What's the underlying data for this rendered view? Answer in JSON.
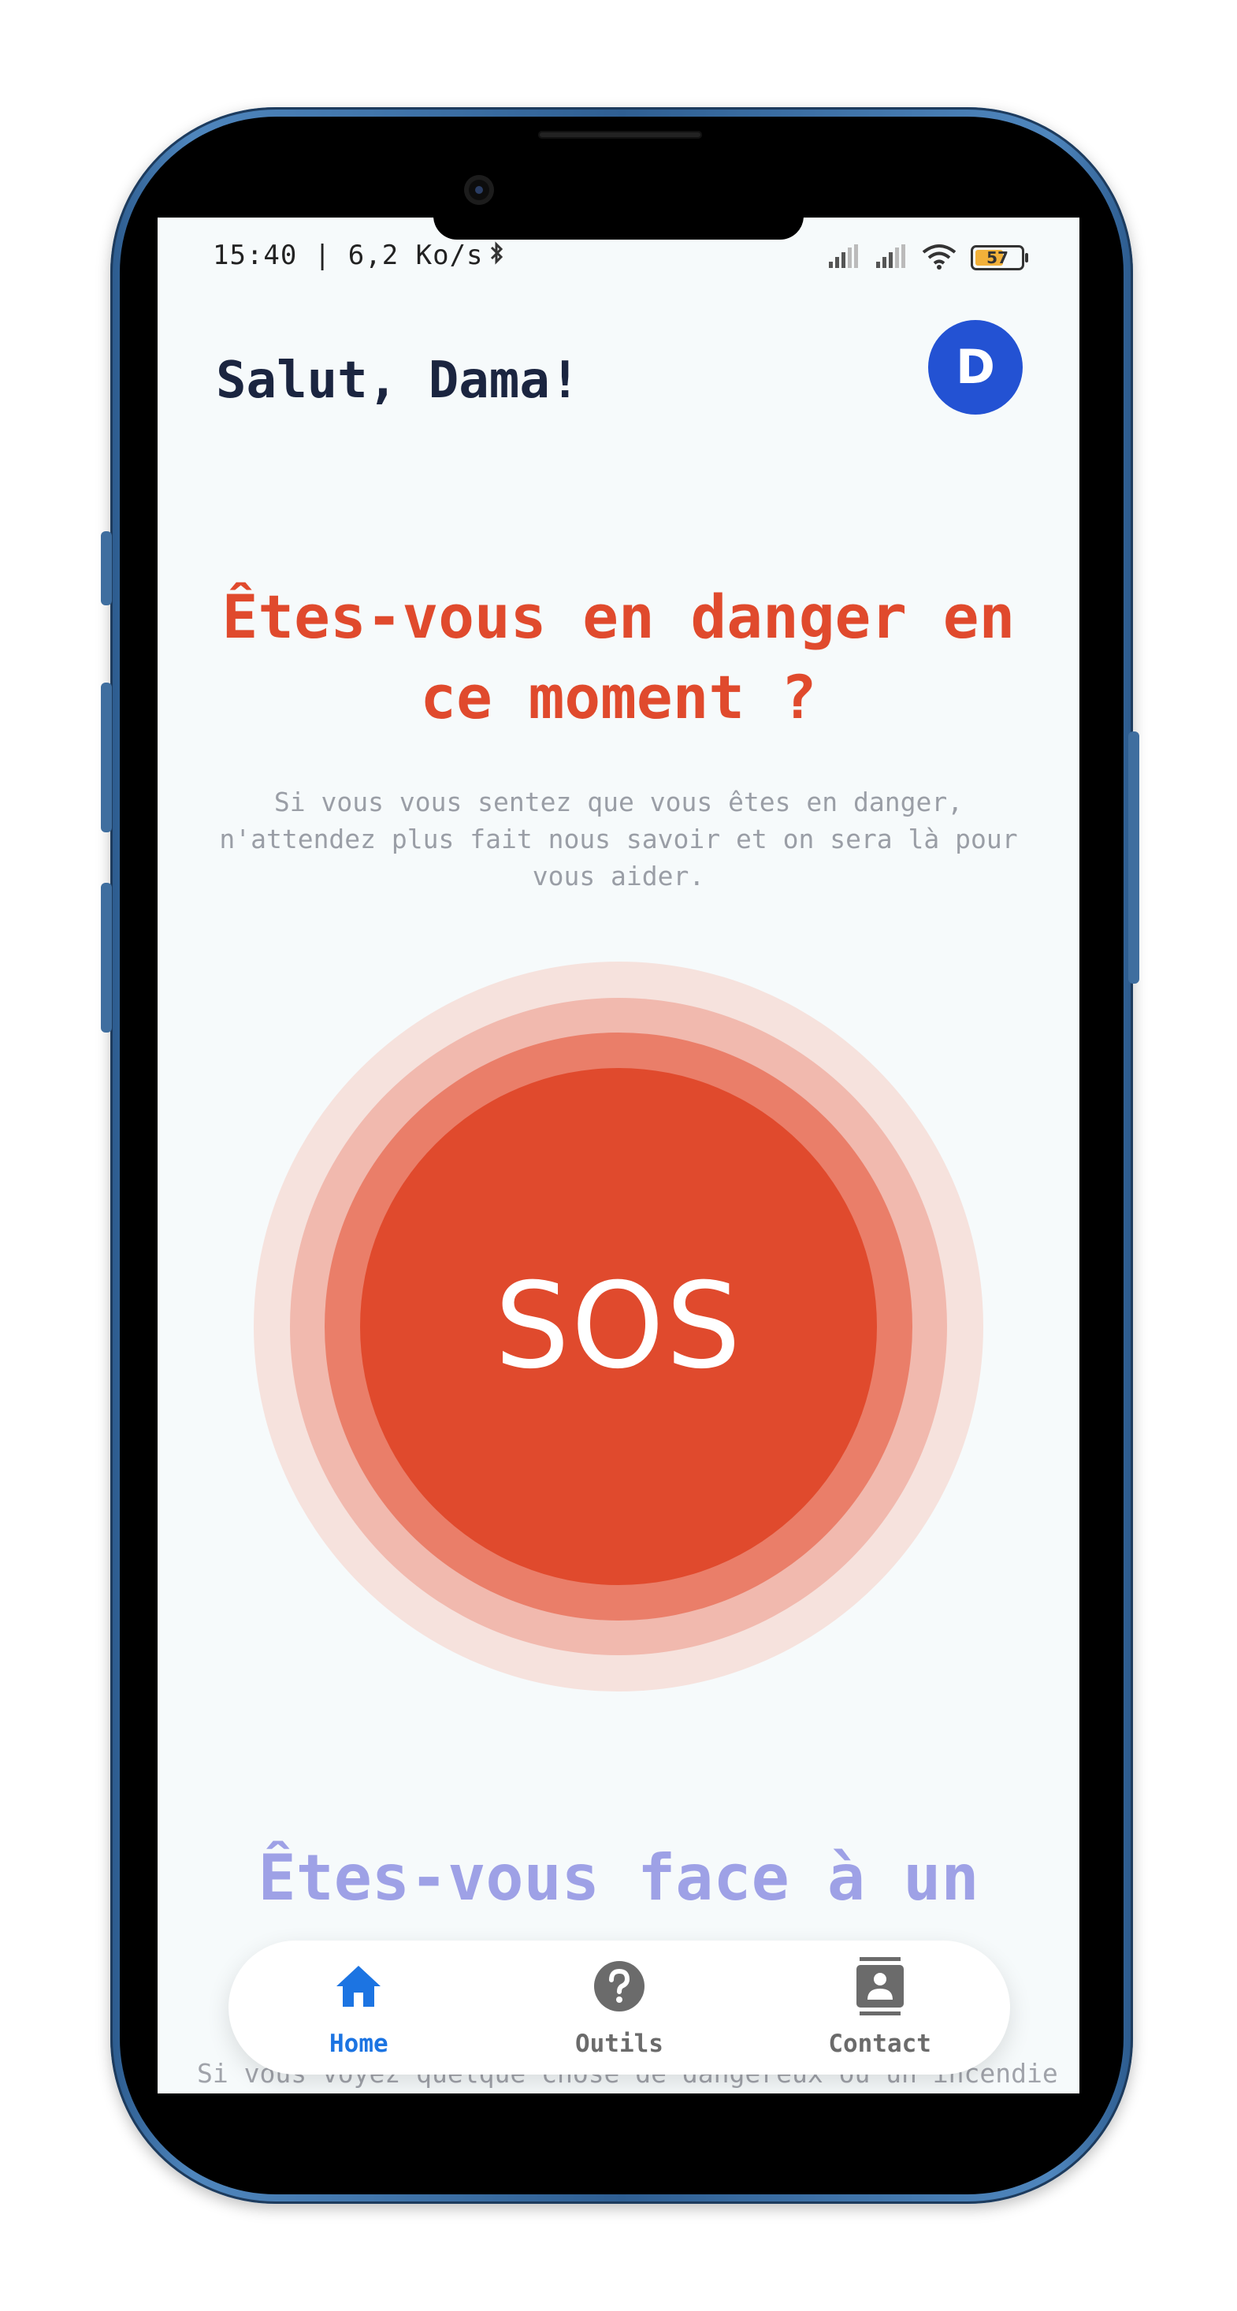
{
  "status_bar": {
    "time": "15:40 | 6,2 Ko/s",
    "battery_level": "57"
  },
  "header": {
    "greeting": "Salut, Dama!",
    "avatar_initial": "D"
  },
  "danger": {
    "title": "Êtes-vous en danger en ce moment ?",
    "description": "Si vous vous sentez que vous êtes en danger, n'attendez plus fait nous savoir et on sera là pour vous aider."
  },
  "sos": {
    "label": "SOS"
  },
  "fire": {
    "title": "Êtes-vous face à un",
    "description": "Si vous voyez quelque chose de dangereux ou un incendie"
  },
  "nav": {
    "items": [
      {
        "label": "Home",
        "icon": "home-icon",
        "active": true
      },
      {
        "label": "Outils",
        "icon": "help-icon",
        "active": false
      },
      {
        "label": "Contact",
        "icon": "contact-icon",
        "active": false
      }
    ]
  },
  "colors": {
    "accent_red": "#e04a2d",
    "avatar_blue": "#2352d3",
    "nav_active": "#1c74e2",
    "secondary_title": "#9ea1e6"
  }
}
